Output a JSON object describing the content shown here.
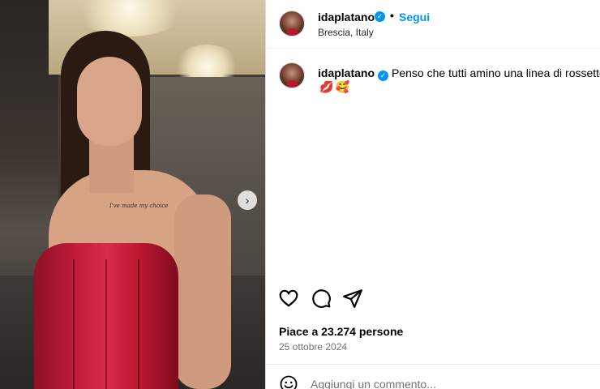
{
  "post": {
    "username": "idaplatano",
    "verified": true,
    "follow_label": "Segui",
    "location": "Brescia, Italy"
  },
  "caption": {
    "username": "idaplatano",
    "text": "Penso che tutti amino una linea di rossetto",
    "emojis": [
      "💋",
      "🥰"
    ]
  },
  "image": {
    "tattoo_text": "I've made my choice"
  },
  "engagement": {
    "likes_text": "Piace a 23.274 persone",
    "date": "25 ottobre 2024"
  },
  "comment": {
    "placeholder": "Aggiungi un commento..."
  },
  "icons": {
    "verified": "verified-badge-icon",
    "like": "heart-icon",
    "comment": "comment-bubble-icon",
    "share": "paper-plane-icon",
    "emoji": "smiley-icon",
    "next": "chevron-right-icon"
  },
  "colors": {
    "accent": "#0095f6",
    "secondary_text": "#737373",
    "border": "#dbdbdb"
  }
}
